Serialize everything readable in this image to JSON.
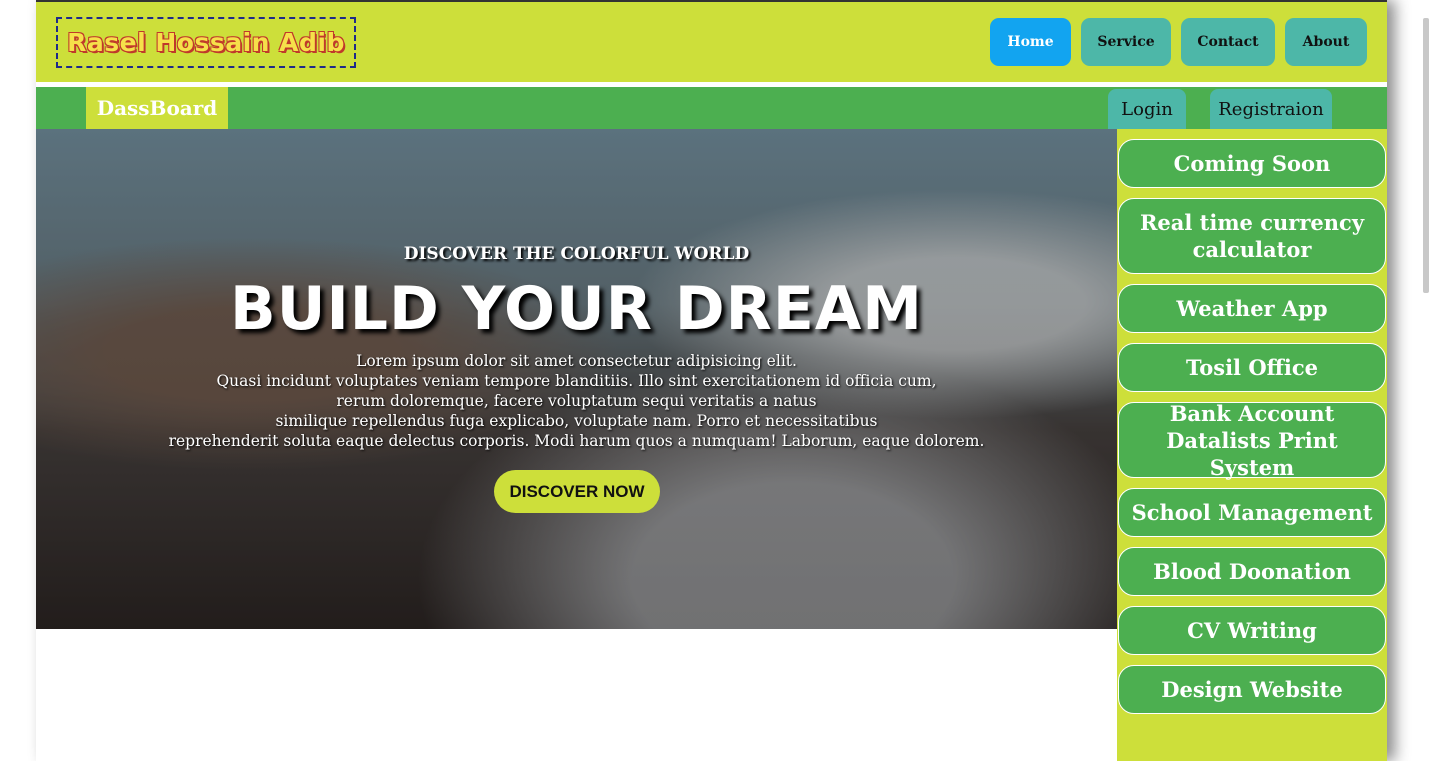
{
  "header": {
    "logo": "Rasel Hossain Adib",
    "nav": [
      "Home",
      "Service",
      "Contact",
      "About"
    ]
  },
  "subnav": {
    "dashboard": "DassBoard",
    "login": "Login",
    "register": "Registraion"
  },
  "hero": {
    "kicker": "DISCOVER THE COLORFUL WORLD",
    "title": "BUILD YOUR DREAM",
    "lines": [
      "Lorem ipsum dolor sit amet consectetur adipisicing elit.",
      "Quasi incidunt voluptates veniam tempore blanditiis. Illo sint exercitationem id officia cum,",
      "rerum doloremque, facere voluptatum sequi veritatis a natus",
      "similique repellendus fuga explicabo, voluptate nam. Porro et necessitatibus",
      "reprehenderit soluta eaque delectus corporis. Modi harum quos a numquam! Laborum, eaque dolorem."
    ],
    "cta": "DISCOVER NOW"
  },
  "sidebar": {
    "items": [
      "Coming Soon",
      "Real time currency calculator",
      "Weather App",
      "Tosil Office",
      "Bank Account Datalists Print System",
      "School Management",
      "Blood Doonation",
      "CV Writing",
      "Design Website"
    ]
  },
  "colors": {
    "lime": "#cddf3a",
    "green": "#4caf50",
    "teal": "#4db7a8",
    "home_active": "#12a4f0"
  }
}
